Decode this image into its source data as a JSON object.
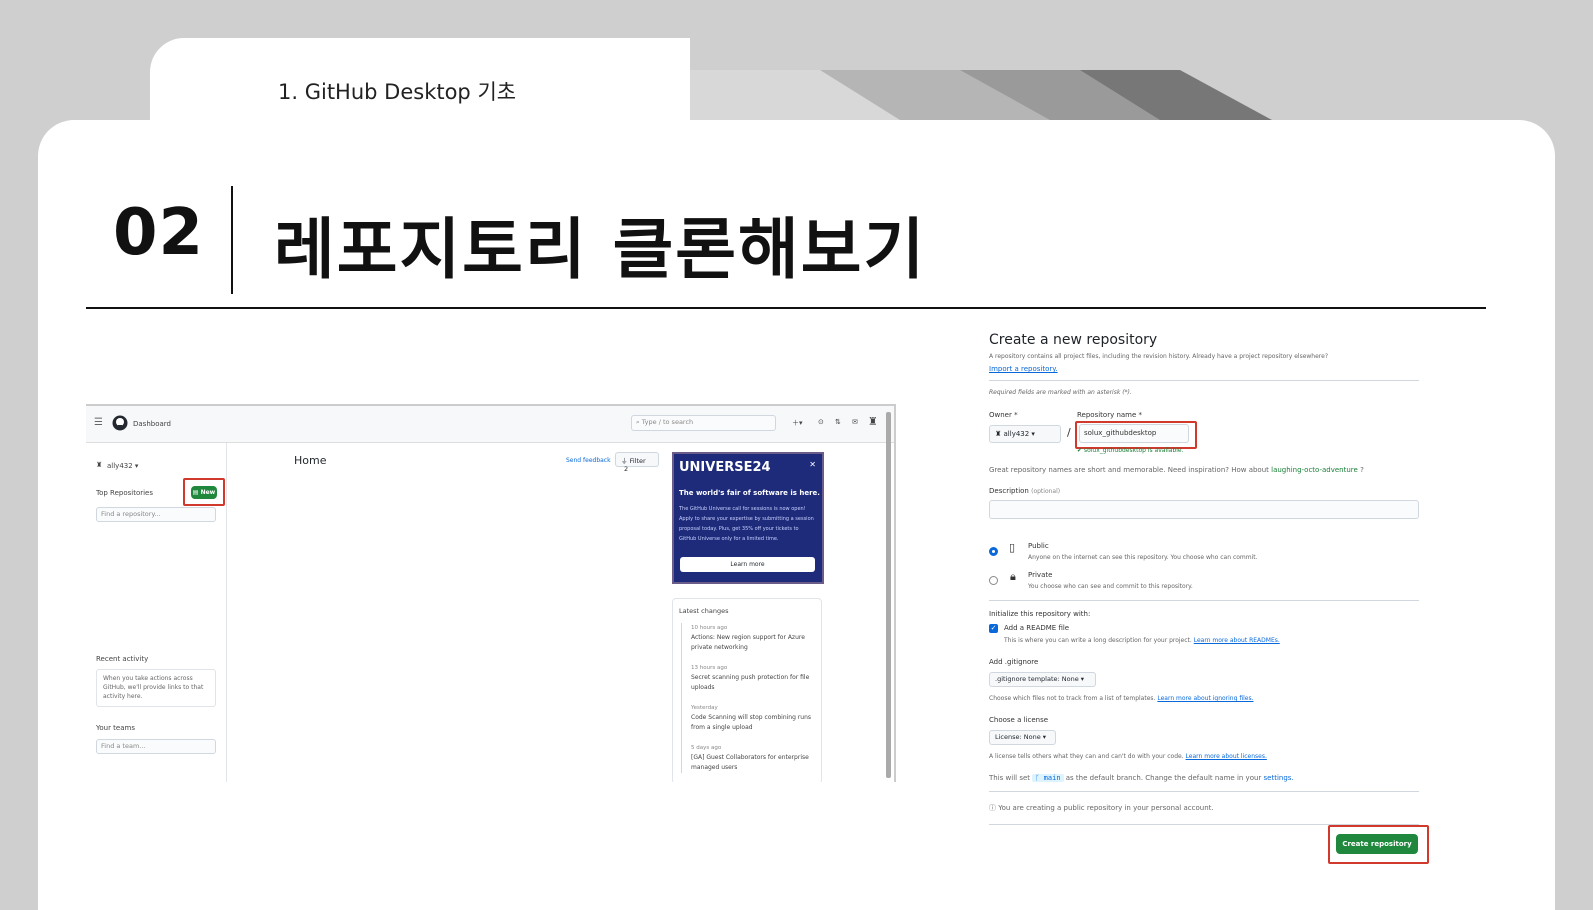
{
  "slide": {
    "section_label": "1. GitHub Desktop 기초",
    "number": "02",
    "title": "레포지토리 클론해보기"
  },
  "github_home": {
    "nav_title": "Dashboard",
    "search_placeholder": "Type / to search",
    "user": "ally432 ▾",
    "top_repos_label": "Top Repositories",
    "new_button": "New",
    "find_repo_placeholder": "Find a repository...",
    "recent_activity_label": "Recent activity",
    "recent_activity_text": "When you take actions across GitHub, we'll provide links to that activity here.",
    "your_teams_label": "Your teams",
    "find_team_placeholder": "Find a team...",
    "home_title": "Home",
    "send_feedback": "Send feedback",
    "filter_label": "Filter",
    "filter_count": "2",
    "promo": {
      "logo": "UNIVERSE24",
      "headline": "The world's fair of software is here.",
      "body": "The GitHub Universe call for sessions is now open! Apply to share your expertise by submitting a session proposal today. Plus, get 35% off your tickets to GitHub Universe only for a limited time.",
      "button": "Learn more"
    },
    "latest_changes_label": "Latest changes",
    "changes": [
      {
        "time": "10 hours ago",
        "text": "Actions: New region support for Azure private networking"
      },
      {
        "time": "13 hours ago",
        "text": "Secret scanning push protection for file uploads"
      },
      {
        "time": "Yesterday",
        "text": "Code Scanning will stop combining runs from a single upload"
      },
      {
        "time": "5 days ago",
        "text": "[GA] Guest Collaborators for enterprise managed users"
      }
    ]
  },
  "new_repo": {
    "title": "Create a new repository",
    "intro": "A repository contains all project files, including the revision history. Already have a project repository elsewhere?",
    "import_link": "Import a repository.",
    "required_note": "Required fields are marked with an asterisk (*).",
    "owner_label": "Owner *",
    "owner_value": "ally432",
    "repo_name_label": "Repository name *",
    "repo_name_value": "solux_githubdesktop",
    "available_msg": "solux_githubdesktop is available.",
    "great_names_prefix": "Great repository names are short and memorable. Need inspiration? How about",
    "suggestion": "laughing-octo-adventure",
    "suggestion_suffix": "?",
    "description_label": "Description",
    "description_optional": "(optional)",
    "public_label": "Public",
    "public_desc": "Anyone on the internet can see this repository. You choose who can commit.",
    "private_label": "Private",
    "private_desc": "You choose who can see and commit to this repository.",
    "init_label": "Initialize this repository with:",
    "readme_label": "Add a README file",
    "readme_desc": "This is where you can write a long description for your project.",
    "readme_link": "Learn more about READMEs.",
    "gitignore_label": "Add .gitignore",
    "gitignore_select": ".gitignore template: None",
    "gitignore_desc": "Choose which files not to track from a list of templates.",
    "gitignore_link": "Learn more about ignoring files.",
    "license_label": "Choose a license",
    "license_select": "License: None",
    "license_desc": "A license tells others what they can and can't do with your code.",
    "license_link": "Learn more about licenses.",
    "branch_prefix": "This will set",
    "branch_name": "main",
    "branch_suffix": "as the default branch. Change the default name in your",
    "settings_link": "settings.",
    "public_notice": "You are creating a public repository in your personal account.",
    "create_button": "Create repository"
  },
  "colors": {
    "accent_green": "#1f883d",
    "highlight_red": "#d0392b",
    "link_blue": "#0969da"
  }
}
